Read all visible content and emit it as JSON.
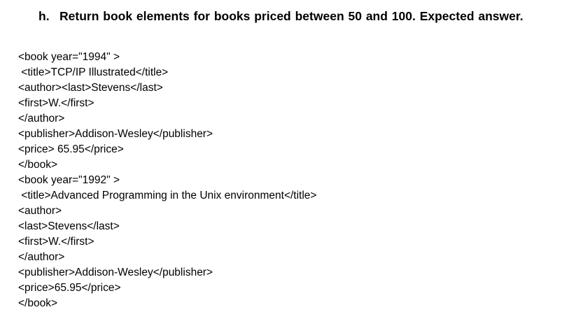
{
  "question": {
    "marker": "h.",
    "text": "Return book elements for books priced between 50 and 100. Expected answer."
  },
  "code_lines": [
    "<book year=\"1994\" >",
    " <title>TCP/IP Illustrated</title>",
    "<author><last>Stevens</last>",
    "<first>W.</first>",
    "</author>",
    "<publisher>Addison-Wesley</publisher>",
    "<price> 65.95</price>",
    "</book>",
    "<book year=\"1992\" >",
    " <title>Advanced Programming in the Unix environment</title>",
    "<author>",
    "<last>Stevens</last>",
    "<first>W.</first>",
    "</author>",
    "<publisher>Addison-Wesley</publisher>",
    "<price>65.95</price>",
    "</book>"
  ]
}
